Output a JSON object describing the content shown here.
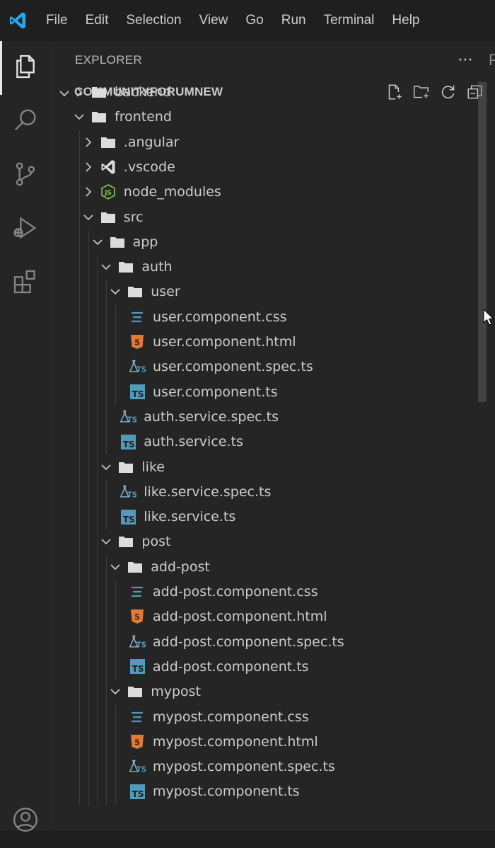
{
  "app": {
    "menu": [
      "File",
      "Edit",
      "Selection",
      "View",
      "Go",
      "Run",
      "Terminal",
      "Help"
    ]
  },
  "colors": {
    "accent_logo": "#23a9f2",
    "folder": "#dcdcdc",
    "ts": "#519aba",
    "html": "#e37933",
    "css": "#519aba",
    "node": "#8bc34a"
  },
  "activity_bar": {
    "items": [
      "files-icon",
      "search-icon",
      "source-control-icon",
      "run-debug-icon",
      "extensions-icon",
      "account-icon"
    ]
  },
  "explorer": {
    "title": "EXPLORER",
    "more": "···",
    "edge_letter": "P",
    "section_title": "COMMUNITYFORUMNEW",
    "tree": [
      {
        "label": "backend",
        "depth": 0,
        "kind": "folder",
        "expanded": false
      },
      {
        "label": "frontend",
        "depth": 0,
        "kind": "folder",
        "expanded": true
      },
      {
        "label": ".angular",
        "depth": 1,
        "kind": "folder",
        "expanded": false
      },
      {
        "label": ".vscode",
        "depth": 1,
        "kind": "vscode",
        "expanded": false
      },
      {
        "label": "node_modules",
        "depth": 1,
        "kind": "node",
        "expanded": false
      },
      {
        "label": "src",
        "depth": 1,
        "kind": "folder",
        "expanded": true
      },
      {
        "label": "app",
        "depth": 2,
        "kind": "folder",
        "expanded": true
      },
      {
        "label": "auth",
        "depth": 3,
        "kind": "folder",
        "expanded": true
      },
      {
        "label": "user",
        "depth": 4,
        "kind": "folder",
        "expanded": true
      },
      {
        "label": "user.component.css",
        "depth": 5,
        "kind": "css"
      },
      {
        "label": "user.component.html",
        "depth": 5,
        "kind": "html"
      },
      {
        "label": "user.component.spec.ts",
        "depth": 5,
        "kind": "spec"
      },
      {
        "label": "user.component.ts",
        "depth": 5,
        "kind": "ts"
      },
      {
        "label": "auth.service.spec.ts",
        "depth": 4,
        "kind": "spec"
      },
      {
        "label": "auth.service.ts",
        "depth": 4,
        "kind": "ts"
      },
      {
        "label": "like",
        "depth": 3,
        "kind": "folder",
        "expanded": true
      },
      {
        "label": "like.service.spec.ts",
        "depth": 4,
        "kind": "spec"
      },
      {
        "label": "like.service.ts",
        "depth": 4,
        "kind": "ts"
      },
      {
        "label": "post",
        "depth": 3,
        "kind": "folder",
        "expanded": true
      },
      {
        "label": "add-post",
        "depth": 4,
        "kind": "folder",
        "expanded": true
      },
      {
        "label": "add-post.component.css",
        "depth": 5,
        "kind": "css"
      },
      {
        "label": "add-post.component.html",
        "depth": 5,
        "kind": "html"
      },
      {
        "label": "add-post.component.spec.ts",
        "depth": 5,
        "kind": "spec"
      },
      {
        "label": "add-post.component.ts",
        "depth": 5,
        "kind": "ts"
      },
      {
        "label": "mypost",
        "depth": 4,
        "kind": "folder",
        "expanded": true
      },
      {
        "label": "mypost.component.css",
        "depth": 5,
        "kind": "css"
      },
      {
        "label": "mypost.component.html",
        "depth": 5,
        "kind": "html"
      },
      {
        "label": "mypost.component.spec.ts",
        "depth": 5,
        "kind": "spec"
      },
      {
        "label": "mypost.component.ts",
        "depth": 5,
        "kind": "ts"
      }
    ]
  }
}
